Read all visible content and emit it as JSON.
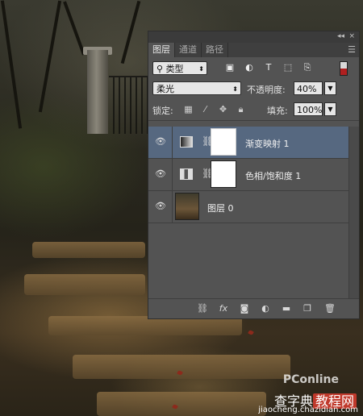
{
  "tabs": [
    "图层",
    "通道",
    "路径"
  ],
  "dock": {
    "collapse": "◂◂",
    "close": "×"
  },
  "filter": {
    "kind": "类型"
  },
  "blend": {
    "mode": "柔光",
    "opacity_label": "不透明度:",
    "opacity": "40%"
  },
  "lock": {
    "label": "锁定:",
    "fill_label": "填充:",
    "fill": "100%"
  },
  "layers": [
    {
      "name": "渐变映射 1",
      "type": "gradient-map",
      "visible": true,
      "selected": true
    },
    {
      "name": "色相/饱和度 1",
      "type": "hue-saturation",
      "visible": true,
      "selected": false
    },
    {
      "name": "图层 0",
      "type": "pixel",
      "visible": true,
      "selected": false
    }
  ],
  "watermark": {
    "brand": "PConline",
    "site": "查字典",
    "site_box": "教程网",
    "url": "jiaocheng.chazidian.com"
  },
  "colors": {
    "panel": "#535353",
    "selected": "#566880",
    "tabbar": "#3f3f3f"
  }
}
